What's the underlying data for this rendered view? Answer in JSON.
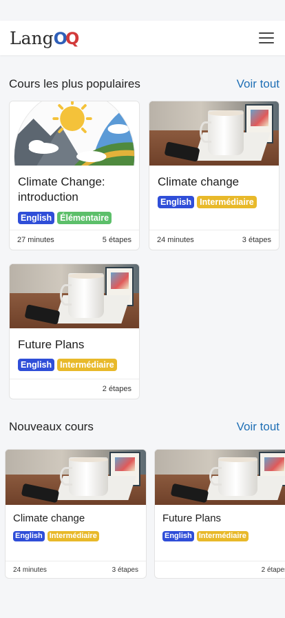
{
  "header": {
    "logo_text": "Lang",
    "logo_o1": "O",
    "logo_o2": "Q"
  },
  "popular": {
    "title": "Cours les plus populaires",
    "see_all": "Voir tout",
    "courses": [
      {
        "title": "Climate Change: introduction",
        "tags": [
          "English",
          "Élémentaire"
        ],
        "duration": "27 minutes",
        "steps": "5 étapes",
        "image": "climate-illustration"
      },
      {
        "title": "Climate change",
        "tags": [
          "English",
          "Intermédiaire"
        ],
        "duration": "24 minutes",
        "steps": "3 étapes",
        "image": "coffee-mug-photo"
      },
      {
        "title": "Future Plans",
        "tags": [
          "English",
          "Intermédiaire"
        ],
        "duration": "",
        "steps": "2 étapes",
        "image": "coffee-mug-photo"
      }
    ]
  },
  "new": {
    "title": "Nouveaux cours",
    "see_all": "Voir tout",
    "courses": [
      {
        "title": "Climate change",
        "tags": [
          "English",
          "Intermédiaire"
        ],
        "duration": "24 minutes",
        "steps": "3 étapes",
        "image": "coffee-mug-photo"
      },
      {
        "title": "Future Plans",
        "tags": [
          "English",
          "Intermédiaire"
        ],
        "duration": "",
        "steps": "2 étapes",
        "image": "coffee-mug-photo"
      }
    ]
  },
  "colors": {
    "accent_link": "#1f6fb5",
    "tag_english": "#2f4ed8",
    "tag_elementaire": "#5cbf6a",
    "tag_intermediaire": "#e8b92a"
  },
  "icons": {
    "menu": "hamburger-icon"
  }
}
